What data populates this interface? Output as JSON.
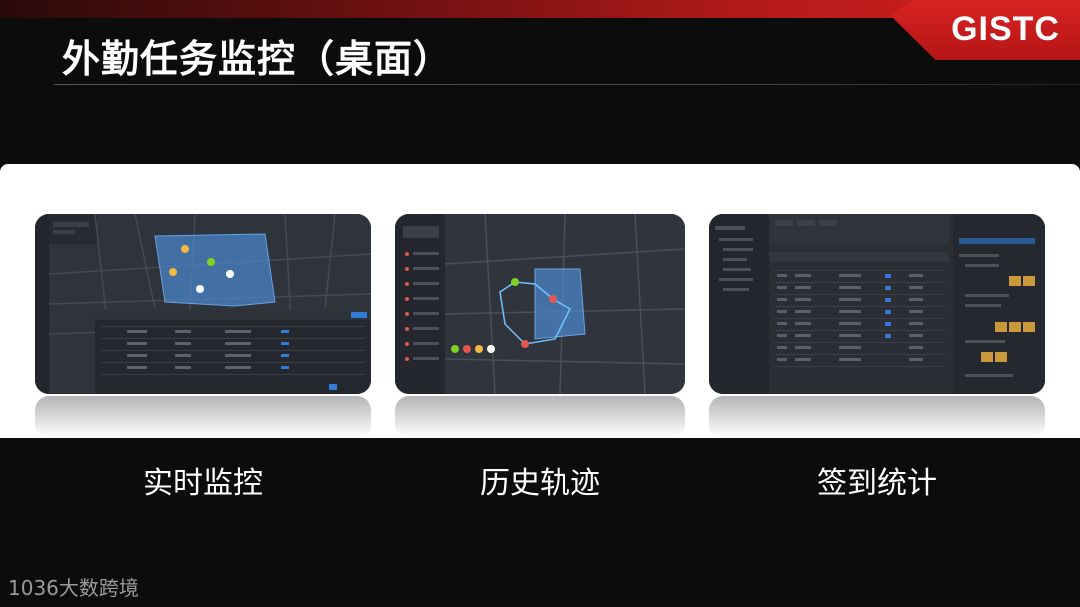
{
  "slide": {
    "title": "外勤任务监控（桌面）",
    "logo": "GISTC",
    "footer_logo": "1036大数跨境"
  },
  "features": [
    {
      "caption": "实时监控",
      "icon": "realtime-monitor-screenshot"
    },
    {
      "caption": "历史轨迹",
      "icon": "history-track-screenshot"
    },
    {
      "caption": "签到统计",
      "icon": "checkin-stats-screenshot"
    }
  ],
  "colors": {
    "background": "#0c0c0c",
    "accent_red": "#d52020",
    "panel": "#ffffff",
    "screen_dark": "#2b2e35",
    "map_region_blue": "#4a86c8"
  }
}
